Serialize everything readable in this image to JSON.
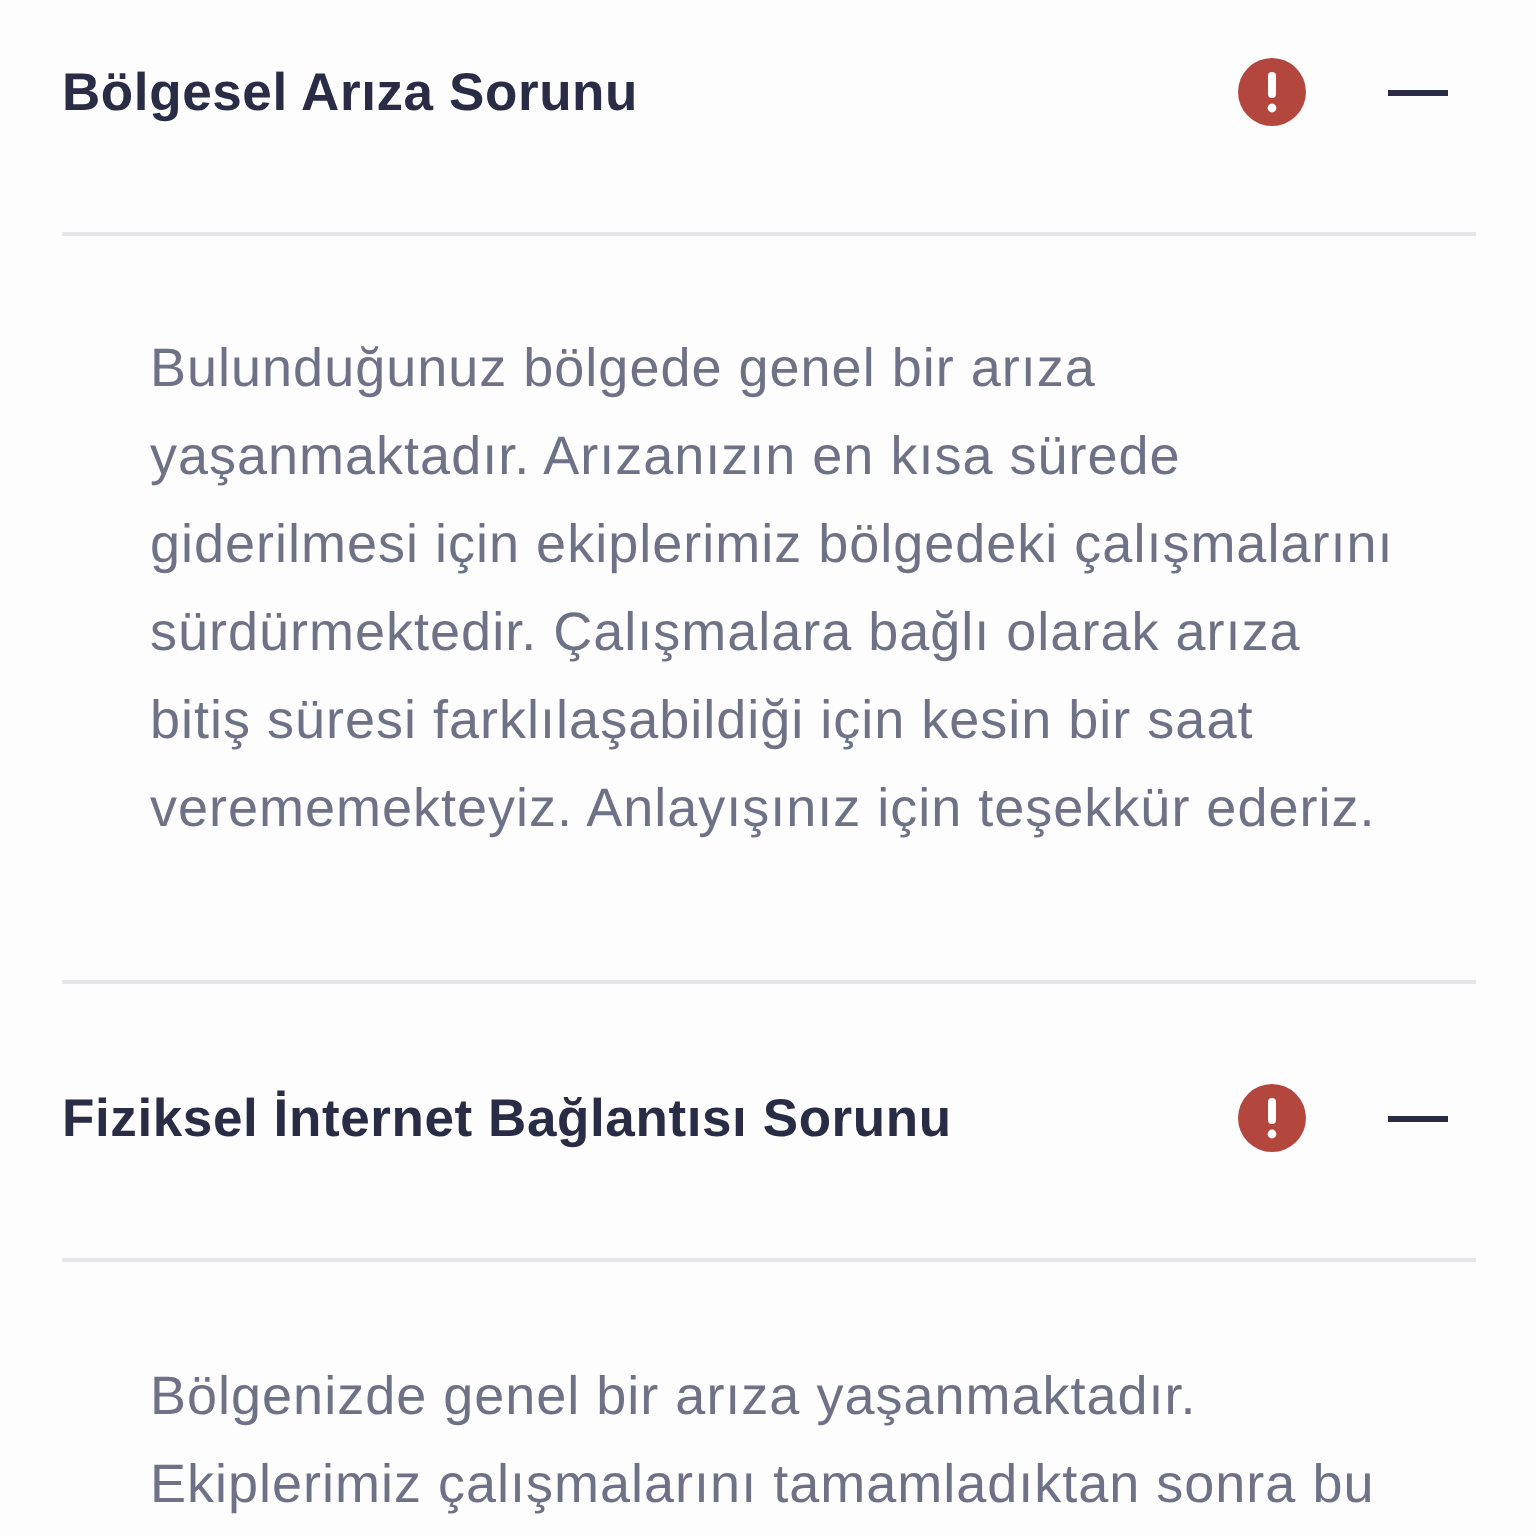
{
  "sections": [
    {
      "title": "Bölgesel Arıza Sorunu",
      "expanded": true,
      "body": "Bulunduğunuz bölgede genel bir arıza yaşanmaktadır. Arızanızın en kısa sürede giderilmesi için ekiplerimiz bölgedeki çalışmalarını sürdürmektedir. Çalışmalara bağlı olarak arıza bitiş süresi farklılaşabildiği için kesin bir saat verememekteyiz. Anlayışınız için teşekkür ederiz."
    },
    {
      "title": "Fiziksel İnternet Bağlantısı Sorunu",
      "expanded": true,
      "body": "Bölgenizde genel bir arıza yaşanmaktadır. Ekiplerimiz çalışmalarını tamamladıktan sonra bu"
    }
  ]
}
